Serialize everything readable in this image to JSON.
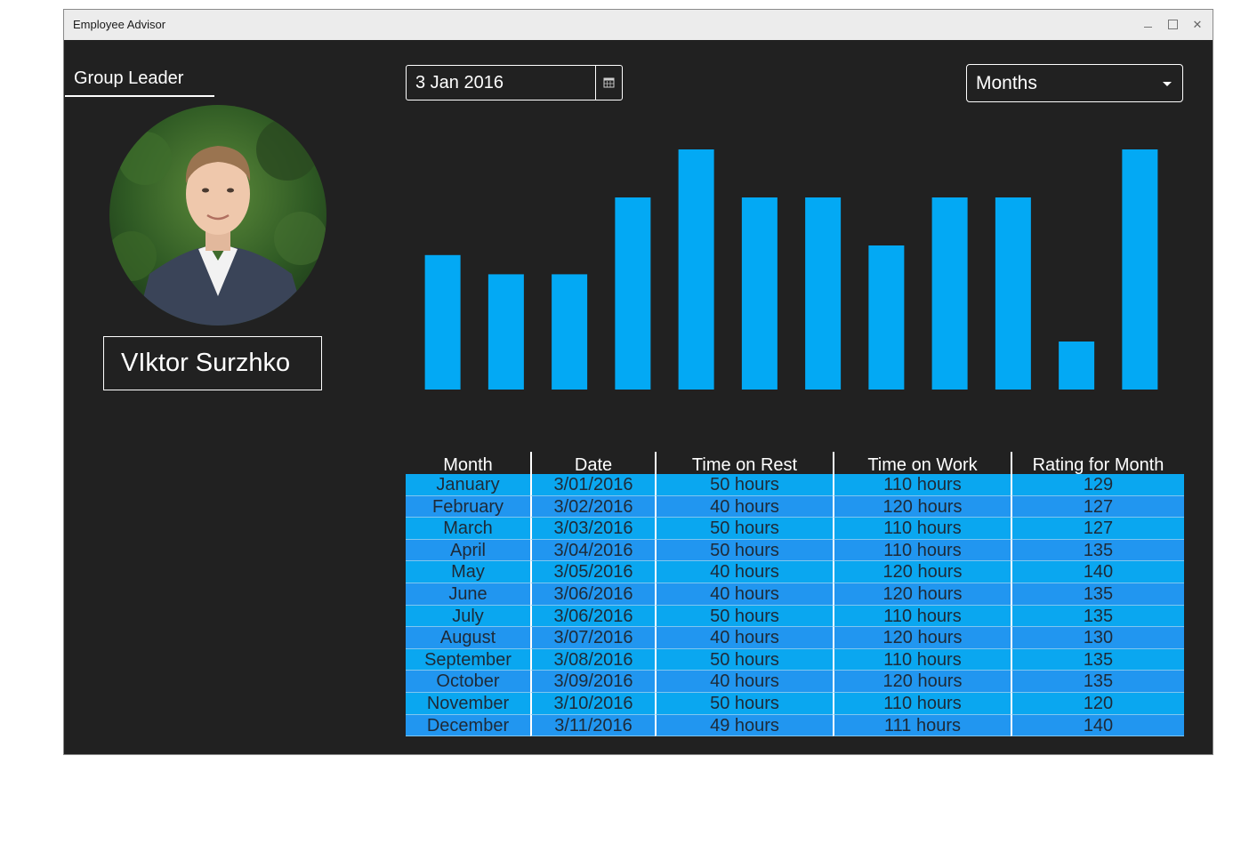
{
  "window": {
    "title": "Employee Advisor"
  },
  "profile": {
    "role": "Group Leader",
    "name": "VIktor Surzhko"
  },
  "controls": {
    "date": "3 Jan 2016",
    "period": "Months"
  },
  "colors": {
    "background": "#212121",
    "accent": "#03a9f4",
    "row_alt": "#2196f0"
  },
  "chart_data": {
    "type": "bar",
    "categories": [
      "January",
      "February",
      "March",
      "April",
      "May",
      "June",
      "July",
      "August",
      "September",
      "October",
      "November",
      "December"
    ],
    "values": [
      129,
      127,
      127,
      135,
      140,
      135,
      135,
      130,
      135,
      135,
      120,
      140
    ],
    "ylim": [
      115,
      140
    ],
    "grid": false,
    "legend": "none",
    "color": "#03a9f4"
  },
  "table": {
    "headers": [
      "Month",
      "Date",
      "Time on Rest",
      "Time on Work",
      "Rating for Month"
    ],
    "rows": [
      [
        "January",
        "3/01/2016",
        "50 hours",
        "110 hours",
        "129"
      ],
      [
        "February",
        "3/02/2016",
        "40 hours",
        "120 hours",
        "127"
      ],
      [
        "March",
        "3/03/2016",
        "50 hours",
        "110 hours",
        "127"
      ],
      [
        "April",
        "3/04/2016",
        "50 hours",
        "110 hours",
        "135"
      ],
      [
        "May",
        "3/05/2016",
        "40 hours",
        "120 hours",
        "140"
      ],
      [
        "June",
        "3/06/2016",
        "40 hours",
        "120 hours",
        "135"
      ],
      [
        "July",
        "3/06/2016",
        "50 hours",
        "110 hours",
        "135"
      ],
      [
        "August",
        "3/07/2016",
        "40 hours",
        "120 hours",
        "130"
      ],
      [
        "September",
        "3/08/2016",
        "50 hours",
        "110 hours",
        "135"
      ],
      [
        "October",
        "3/09/2016",
        "40 hours",
        "120 hours",
        "135"
      ],
      [
        "November",
        "3/10/2016",
        "50 hours",
        "110 hours",
        "120"
      ],
      [
        "December",
        "3/11/2016",
        "49 hours",
        "111 hours",
        "140"
      ]
    ]
  }
}
